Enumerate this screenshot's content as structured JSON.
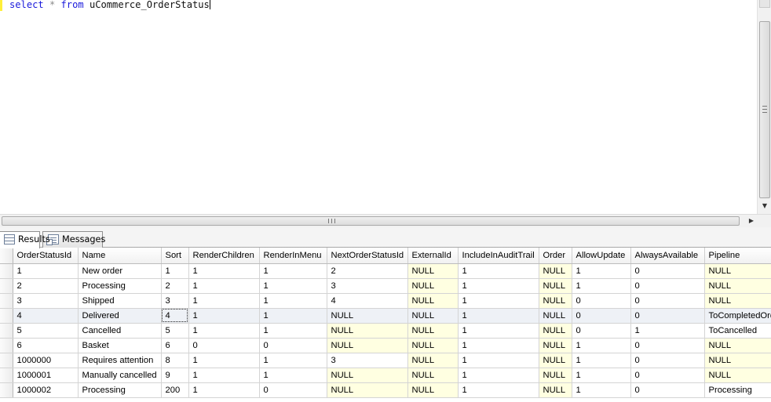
{
  "editor": {
    "sql": {
      "select": "select",
      "star": "*",
      "from": "from",
      "table": "uCommerce_OrderStatus"
    }
  },
  "tabs": [
    {
      "label": "Results",
      "icon": "results-grid-icon",
      "active": true
    },
    {
      "label": "Messages",
      "icon": "messages-icon",
      "active": false
    }
  ],
  "grid": {
    "columns": [
      "OrderStatusId",
      "Name",
      "Sort",
      "RenderChildren",
      "RenderInMenu",
      "NextOrderStatusId",
      "ExternalId",
      "IncludeInAuditTrail",
      "Order",
      "AllowUpdate",
      "AlwaysAvailable",
      "Pipeline"
    ],
    "rows": [
      [
        "1",
        "New order",
        "1",
        "1",
        "1",
        "2",
        "NULL",
        "1",
        "NULL",
        "1",
        "0",
        "NULL"
      ],
      [
        "2",
        "Processing",
        "2",
        "1",
        "1",
        "3",
        "NULL",
        "1",
        "NULL",
        "1",
        "0",
        "NULL"
      ],
      [
        "3",
        "Shipped",
        "3",
        "1",
        "1",
        "4",
        "NULL",
        "1",
        "NULL",
        "0",
        "0",
        "NULL"
      ],
      [
        "4",
        "Delivered",
        "4",
        "1",
        "1",
        "NULL",
        "NULL",
        "1",
        "NULL",
        "0",
        "0",
        "ToCompletedOrder"
      ],
      [
        "5",
        "Cancelled",
        "5",
        "1",
        "1",
        "NULL",
        "NULL",
        "1",
        "NULL",
        "0",
        "1",
        "ToCancelled"
      ],
      [
        "6",
        "Basket",
        "6",
        "0",
        "0",
        "NULL",
        "NULL",
        "1",
        "NULL",
        "1",
        "0",
        "NULL"
      ],
      [
        "1000000",
        "Requires attention",
        "8",
        "1",
        "1",
        "3",
        "NULL",
        "1",
        "NULL",
        "1",
        "0",
        "NULL"
      ],
      [
        "1000001",
        "Manually cancelled",
        "9",
        "1",
        "1",
        "NULL",
        "NULL",
        "1",
        "NULL",
        "1",
        "0",
        "NULL"
      ],
      [
        "1000002",
        "Processing",
        "200",
        "1",
        "0",
        "NULL",
        "NULL",
        "1",
        "NULL",
        "1",
        "0",
        "Processing"
      ]
    ],
    "selected_row": 3,
    "focused_cell": [
      3,
      2
    ]
  },
  "colors": {
    "keyword": "#1a1adb",
    "null_cell": "#ffffe1",
    "selected_row": "#eef1f6"
  }
}
